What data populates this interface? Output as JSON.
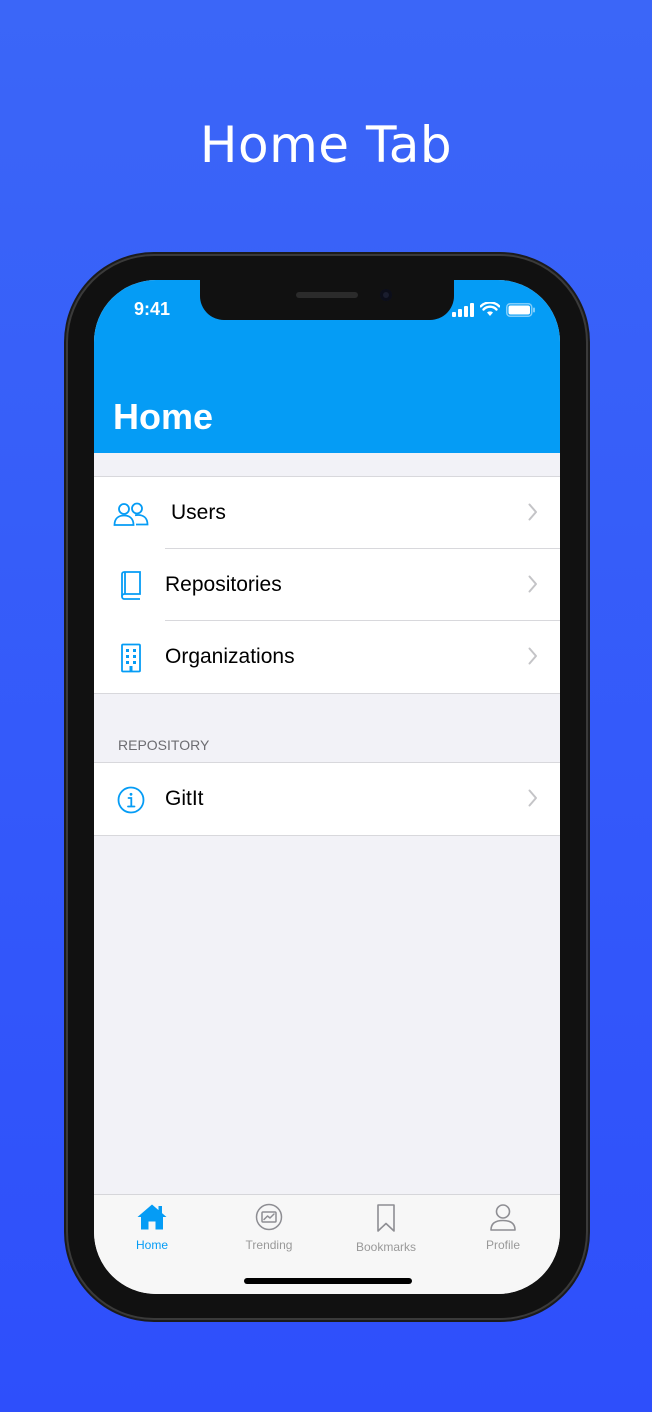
{
  "promo": {
    "title": "Home Tab"
  },
  "status_bar": {
    "time": "9:41",
    "icons": [
      "signal-icon",
      "wifi-icon",
      "battery-icon"
    ]
  },
  "navbar": {
    "title": "Home",
    "color": "#059cf5"
  },
  "groups": [
    {
      "header": "",
      "items": [
        {
          "label": "Users",
          "icon": "users-icon"
        },
        {
          "label": "Repositories",
          "icon": "book-icon"
        },
        {
          "label": "Organizations",
          "icon": "building-icon"
        }
      ]
    },
    {
      "header": "REPOSITORY",
      "items": [
        {
          "label": "GitIt",
          "icon": "info-icon"
        }
      ]
    }
  ],
  "tabbar": {
    "tabs": [
      {
        "label": "Home",
        "icon": "house-icon",
        "active": true
      },
      {
        "label": "Trending",
        "icon": "trending-icon",
        "active": false
      },
      {
        "label": "Bookmarks",
        "icon": "bookmark-icon",
        "active": false
      },
      {
        "label": "Profile",
        "icon": "person-icon",
        "active": false
      }
    ]
  },
  "colors": {
    "accent": "#059cf5",
    "background_top": "#3b66f8",
    "background_bottom": "#2e4ffb"
  }
}
